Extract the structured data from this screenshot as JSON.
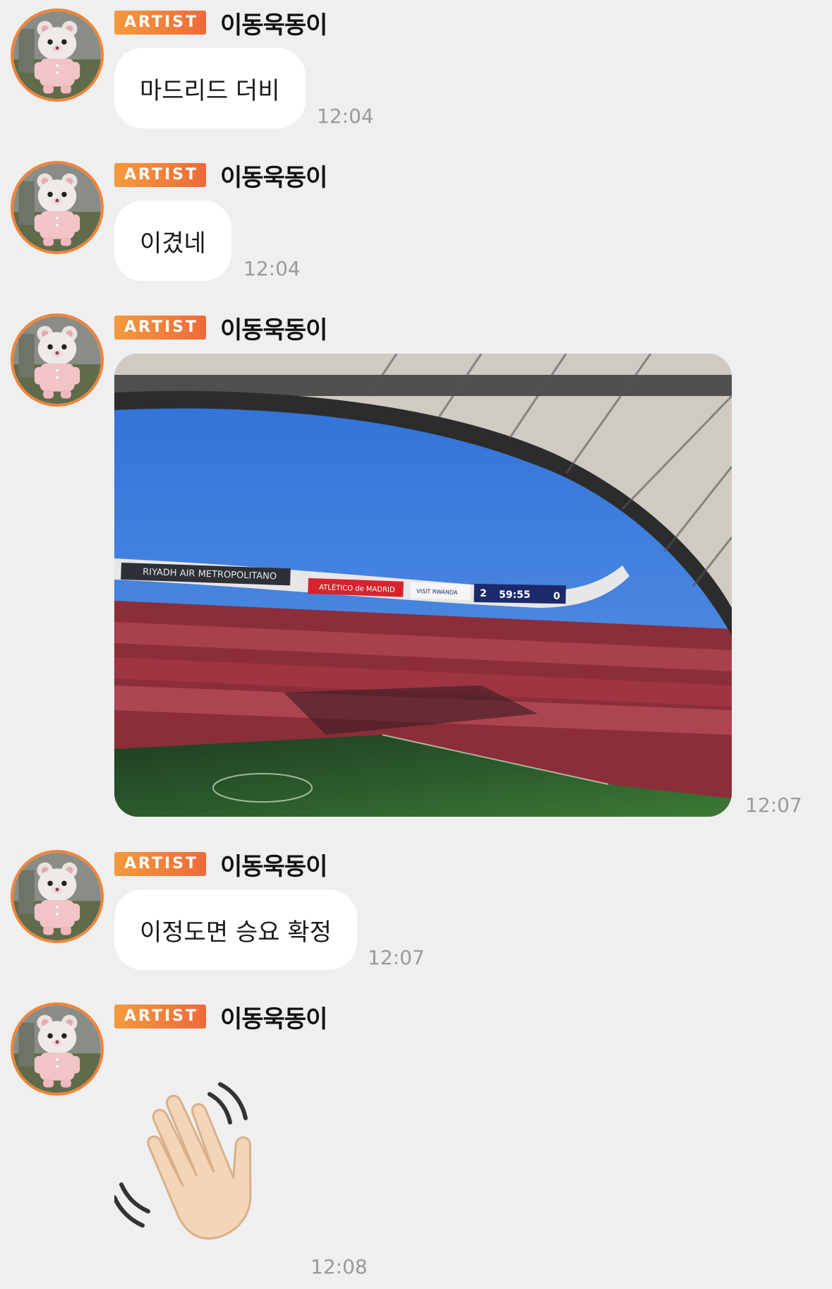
{
  "sender": {
    "badge": "ARTIST",
    "name": "이동욱동이"
  },
  "messages": [
    {
      "type": "text",
      "text": "마드리드 더비",
      "time": "12:04"
    },
    {
      "type": "text",
      "text": "이겼네",
      "time": "12:04"
    },
    {
      "type": "image",
      "time": "12:07",
      "image": {
        "icon": "stadium-photo",
        "board_stadium": "RIYADH AIR METROPOLITANO",
        "board_club": "ATLÉTICO de MADRID",
        "board_visit": "VISIT RWANDA",
        "score_home": "2",
        "clock": "59:55",
        "score_away": "0"
      }
    },
    {
      "type": "text",
      "text": "이정도면 승요 확정",
      "time": "12:07"
    },
    {
      "type": "emoji",
      "icon": "waving-hand-icon",
      "time": "12:08"
    }
  ]
}
